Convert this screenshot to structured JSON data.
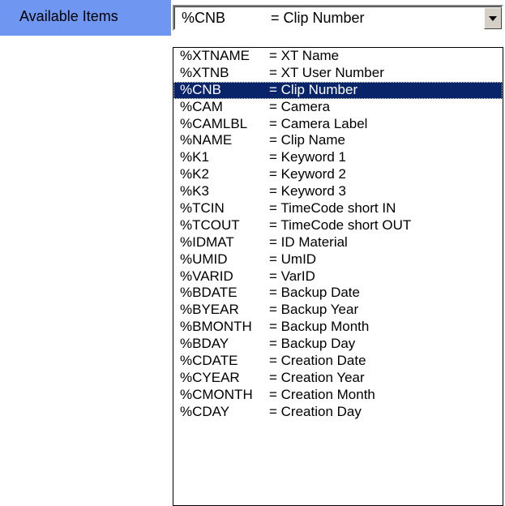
{
  "label": {
    "text": "Available Items"
  },
  "combo": {
    "value_code": "%CNB",
    "value_desc": "= Clip Number"
  },
  "dropdown": {
    "selected_index": 2,
    "items": [
      {
        "code": "%XTNAME",
        "desc": "= XT Name"
      },
      {
        "code": "%XTNB",
        "desc": "= XT User Number"
      },
      {
        "code": "%CNB",
        "desc": "= Clip Number"
      },
      {
        "code": "%CAM",
        "desc": "= Camera"
      },
      {
        "code": "%CAMLBL",
        "desc": "= Camera Label"
      },
      {
        "code": "%NAME",
        "desc": "= Clip Name"
      },
      {
        "code": "%K1",
        "desc": "= Keyword 1"
      },
      {
        "code": "%K2",
        "desc": "= Keyword 2"
      },
      {
        "code": "%K3",
        "desc": "= Keyword 3"
      },
      {
        "code": "%TCIN",
        "desc": "= TimeCode short IN"
      },
      {
        "code": "%TCOUT",
        "desc": "= TimeCode short OUT"
      },
      {
        "code": "%IDMAT",
        "desc": "= ID Material"
      },
      {
        "code": "%UMID",
        "desc": "= UmID"
      },
      {
        "code": "%VARID",
        "desc": "= VarID"
      },
      {
        "code": "%BDATE",
        "desc": "= Backup Date"
      },
      {
        "code": "%BYEAR",
        "desc": "= Backup Year"
      },
      {
        "code": "%BMONTH",
        "desc": "= Backup Month"
      },
      {
        "code": "%BDAY",
        "desc": "= Backup Day"
      },
      {
        "code": "%CDATE",
        "desc": "= Creation Date"
      },
      {
        "code": "%CYEAR",
        "desc": "= Creation Year"
      },
      {
        "code": "%CMONTH",
        "desc": "= Creation Month"
      },
      {
        "code": "%CDAY",
        "desc": "= Creation Day"
      }
    ]
  },
  "colors": {
    "label_bg": "#6f96f0",
    "selection_bg": "#0a246a",
    "button_face": "#d4d0c8"
  },
  "icons": {
    "dropdown_arrow": "chevron-down-icon"
  }
}
